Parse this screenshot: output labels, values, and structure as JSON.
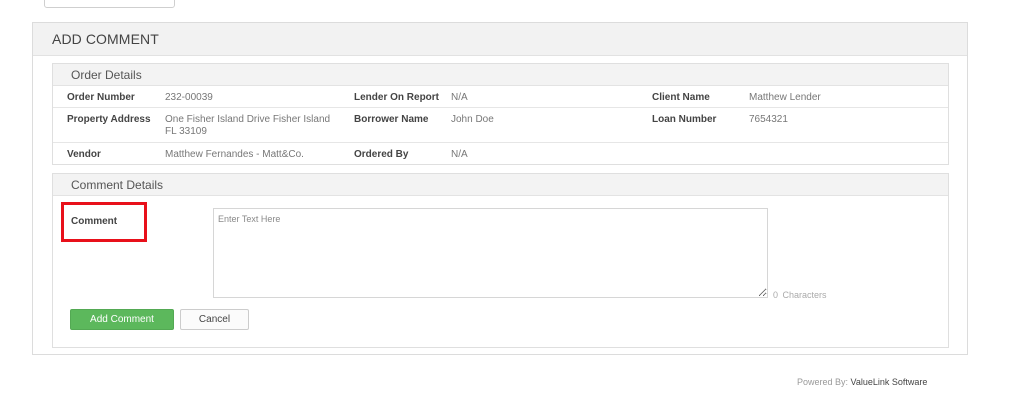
{
  "panel": {
    "title": "ADD COMMENT"
  },
  "order_details": {
    "heading": "Order Details",
    "rows": [
      [
        {
          "label": "Order Number",
          "value": "232-00039"
        },
        {
          "label": "Lender On Report",
          "value": "N/A"
        },
        {
          "label": "Client Name",
          "value": "Matthew Lender"
        }
      ],
      [
        {
          "label": "Property Address",
          "value": "One Fisher Island Drive Fisher Island FL 33109"
        },
        {
          "label": "Borrower Name",
          "value": "John Doe"
        },
        {
          "label": "Loan Number",
          "value": "7654321"
        }
      ],
      [
        {
          "label": "Vendor",
          "value": "Matthew Fernandes - Matt&Co."
        },
        {
          "label": "Ordered By",
          "value": "N/A"
        }
      ]
    ]
  },
  "comment_details": {
    "heading": "Comment Details",
    "comment_label": "Comment",
    "textarea_placeholder": "Enter Text Here",
    "textarea_value": "",
    "char_count": "0",
    "char_suffix": "Characters",
    "add_button": "Add Comment",
    "cancel_button": "Cancel",
    "highlight_color": "#e8101a"
  },
  "footer": {
    "prefix": "Powered By:",
    "brand": "ValueLink Software"
  },
  "colors": {
    "primary_button": "#5cb85c",
    "panel_header": "#f2f2f2"
  }
}
